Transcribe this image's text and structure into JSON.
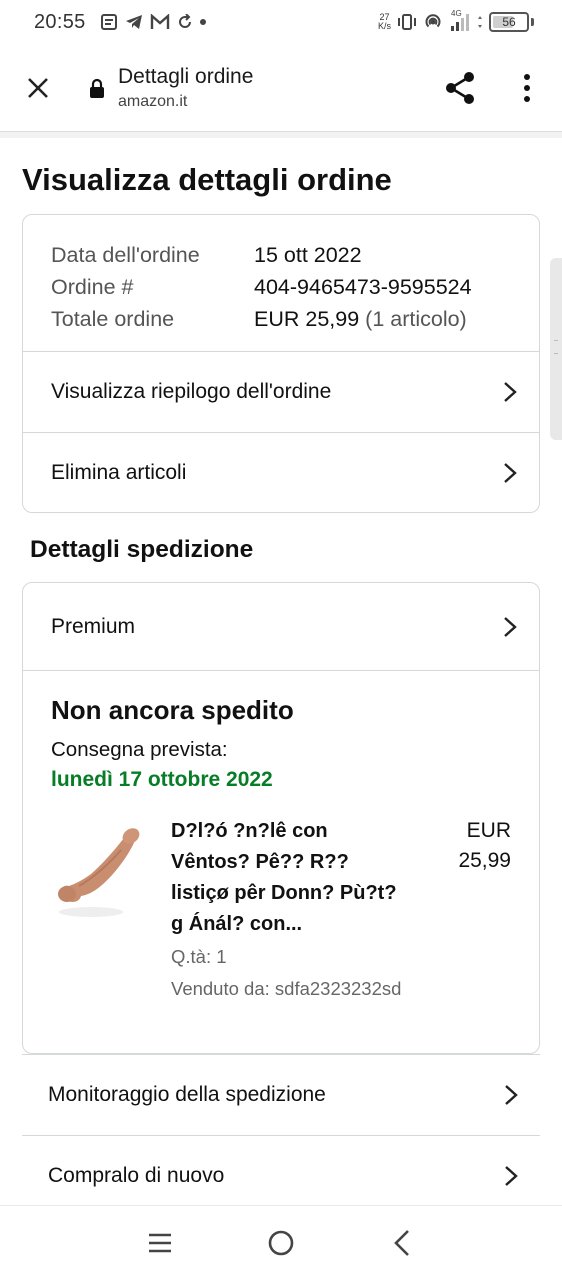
{
  "status_bar": {
    "time": "20:55",
    "net_speed_value": "27",
    "net_speed_unit": "K/s",
    "network_type": "4G",
    "battery_level": "56",
    "battery_fraction": 0.56
  },
  "browser": {
    "page_title": "Dettagli ordine",
    "domain": "amazon.it"
  },
  "page": {
    "heading": "Visualizza dettagli ordine"
  },
  "order": {
    "date_label": "Data dell'ordine",
    "date_value": "15 ott 2022",
    "number_label": "Ordine #",
    "number_value": "404-9465473-9595524",
    "total_label": "Totale ordine",
    "total_value": "EUR 25,99",
    "total_items": "(1 articolo)",
    "summary_link": "Visualizza riepilogo dell'ordine",
    "delete_link": "Elimina articoli"
  },
  "shipping": {
    "heading": "Dettagli spedizione",
    "shipping_type": "Premium",
    "status": "Non ancora spedito",
    "delivery_label": "Consegna prevista:",
    "delivery_date": "lunedì 17 ottobre 2022",
    "delivery_date_color": "#067d26",
    "product": {
      "title": "D?l?ó ?n?lê con Vêntos? Pê?? R?? listiçø pêr Donn? Pù?t? g Ánál? con...",
      "price_currency": "EUR",
      "price_amount": "25,99",
      "quantity": "Q.tà: 1",
      "seller": "Venduto da: sdfa2323232sd"
    }
  },
  "links": {
    "tracking": "Monitoraggio della spedizione",
    "buy_again": "Compralo di nuovo"
  }
}
